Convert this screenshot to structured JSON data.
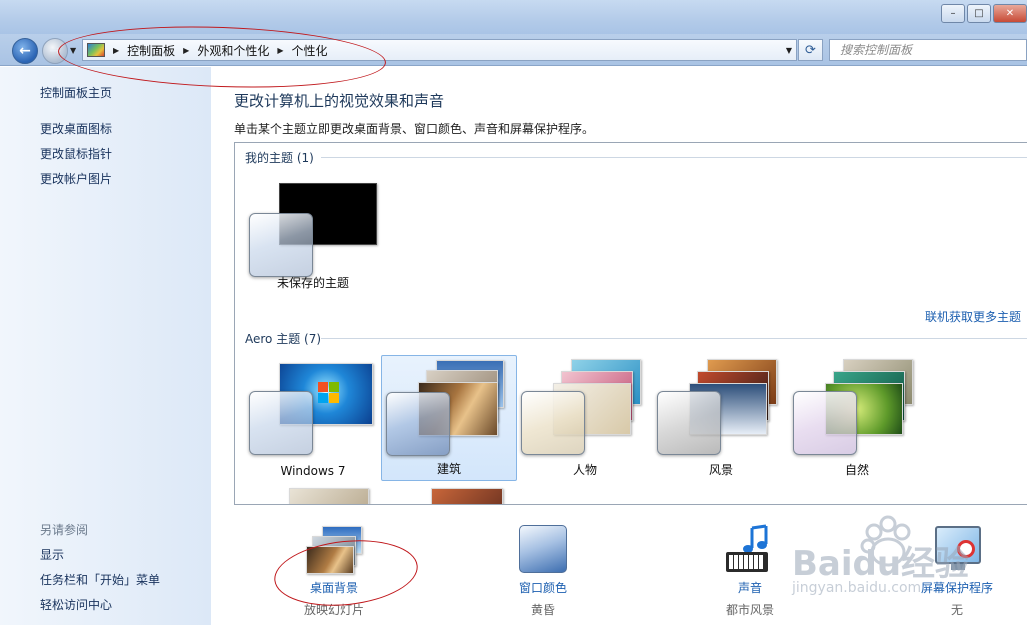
{
  "window": {
    "controls": [
      "minimize",
      "maximize",
      "close"
    ],
    "min_label": "–",
    "max_label": "□",
    "close_label": "✕"
  },
  "address": {
    "breadcrumbs": [
      "控制面板",
      "外观和个性化",
      "个性化"
    ],
    "search_placeholder": "搜索控制面板",
    "refresh_label": "⟳"
  },
  "sidebar": {
    "home_link": "控制面板主页",
    "tasks": [
      "更改桌面图标",
      "更改鼠标指针",
      "更改帐户图片"
    ],
    "see_also_title": "另请参阅",
    "see_also": [
      "显示",
      "任务栏和「开始」菜单",
      "轻松访问中心"
    ]
  },
  "main": {
    "title": "更改计算机上的视觉效果和声音",
    "description": "单击某个主题立即更改桌面背景、窗口颜色、声音和屏幕保护程序。",
    "my_themes": {
      "title": "我的主题 (1)",
      "items": [
        {
          "label": "未保存的主题"
        }
      ]
    },
    "online_link": "联机获取更多主题",
    "aero_themes": {
      "title": "Aero 主题 (7)",
      "items": [
        {
          "label": "Windows 7"
        },
        {
          "label": "建筑",
          "selected": true
        },
        {
          "label": "人物"
        },
        {
          "label": "风景"
        },
        {
          "label": "自然"
        }
      ]
    }
  },
  "settings": [
    {
      "label": "桌面背景",
      "sub": "放映幻灯片",
      "icon": "desktop-background-icon"
    },
    {
      "label": "窗口颜色",
      "sub": "黄昏",
      "icon": "window-color-icon"
    },
    {
      "label": "声音",
      "sub": "都市风景",
      "icon": "sounds-icon"
    },
    {
      "label": "屏幕保护程序",
      "sub": "无",
      "icon": "screensaver-icon"
    }
  ],
  "watermark": {
    "brand": "Baidu经验",
    "url": "jingyan.baidu.com"
  },
  "colors": {
    "link": "#1c5fb0",
    "heading": "#1e395b",
    "annotation": "#c0181c"
  }
}
